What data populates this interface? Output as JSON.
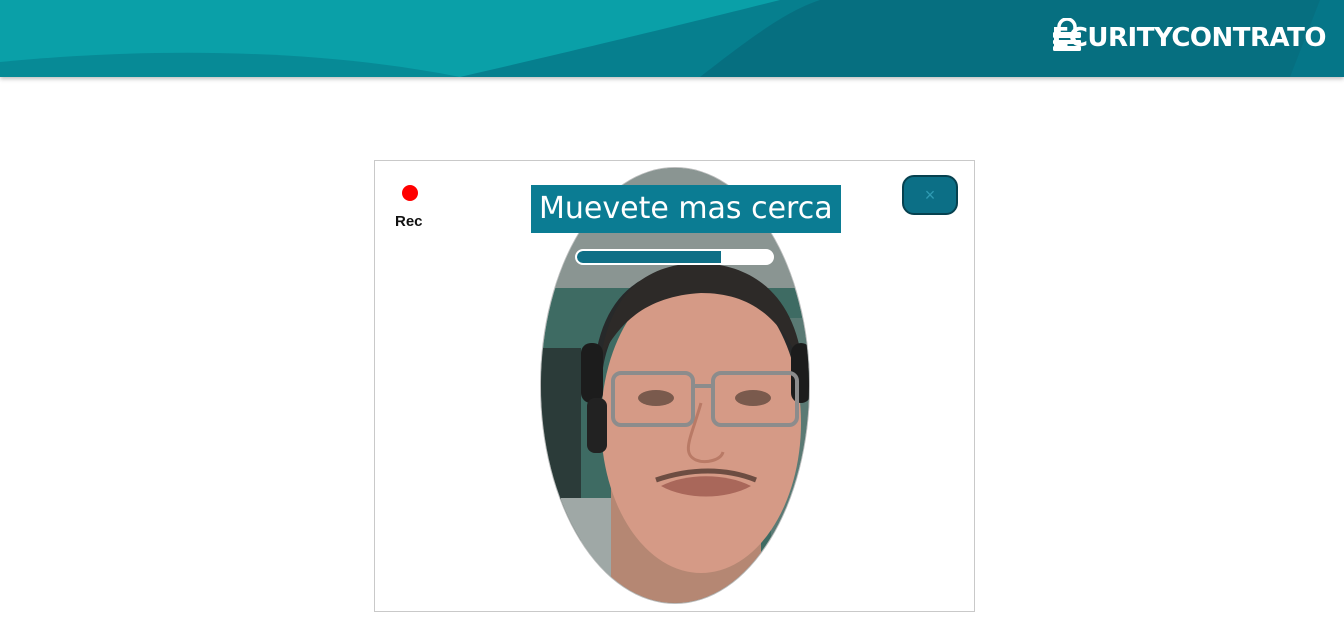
{
  "header": {
    "brand_name": "SECURITYCONTRATO",
    "brand_text": "ECURITYCONTRATO",
    "colors": {
      "primary": "#0a9aa3",
      "dark": "#046e7d"
    }
  },
  "capture": {
    "recording_label": "Rec",
    "instruction": "Muevete mas cerca",
    "progress_percent": 74,
    "close_icon": "close-icon",
    "close_glyph": "×"
  }
}
